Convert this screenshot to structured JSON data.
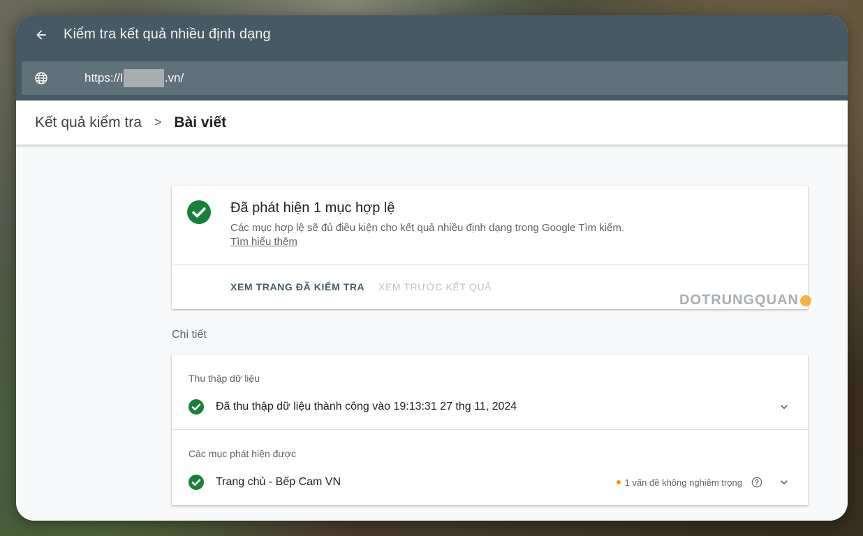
{
  "header": {
    "title": "Kiểm tra kết quả nhiều định dạng",
    "url_prefix": "https://l",
    "url_suffix": ".vn/"
  },
  "breadcrumb": {
    "parent": "Kết quả kiểm tra",
    "separator": ">",
    "current": "Bài viết"
  },
  "summary": {
    "title": "Đã phát hiện 1 mục hợp lệ",
    "description": "Các mục hợp lệ sẽ đủ điều kiện cho kết quả nhiều định dạng trong Google Tìm kiếm.",
    "learn_more": "Tìm hiểu thêm",
    "view_page_button": "XEM TRANG ĐÃ KIỂM TRA",
    "preview_button": "XEM TRƯỚC KẾT QUẢ"
  },
  "watermark": "DOTRUNGQUAN",
  "details": {
    "label": "Chi tiết",
    "crawl": {
      "heading": "Thu thập dữ liệu",
      "status": "Đã thu thập dữ liệu thành công vào 19:13:31 27 thg 11, 2024"
    },
    "detected": {
      "heading": "Các mục phát hiện được",
      "item": "Trang chủ - Bếp Cam VN",
      "issue": "1 vấn đề không nghiêm trọng"
    }
  },
  "colors": {
    "topbar": "#455a64",
    "success": "#188038",
    "warning": "#f29900"
  }
}
